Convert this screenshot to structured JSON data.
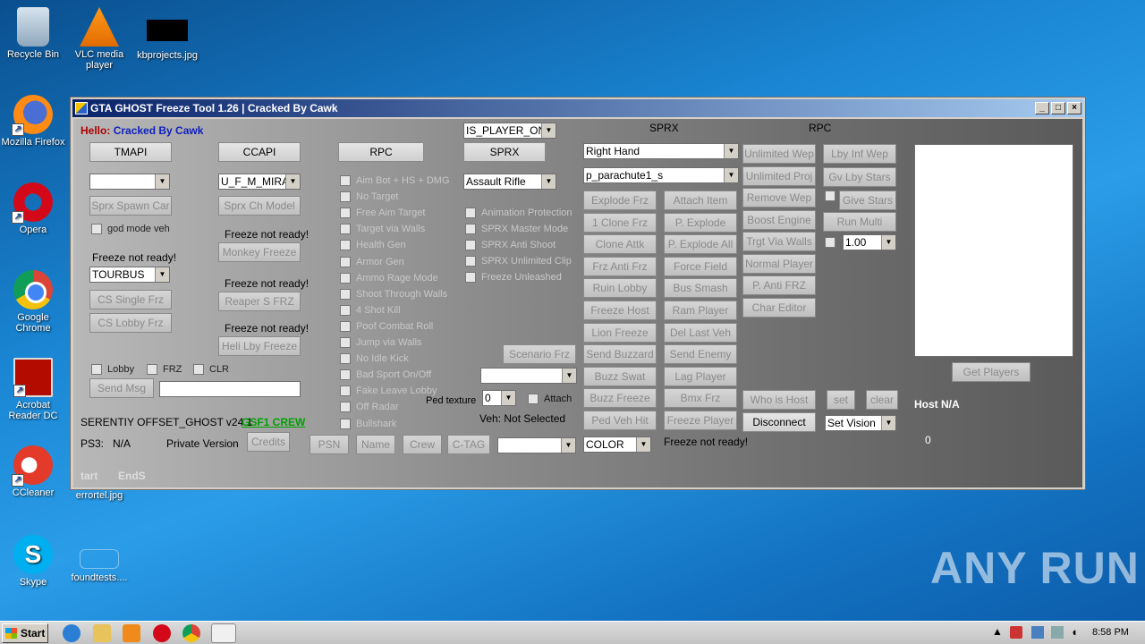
{
  "desktop": {
    "icons": [
      {
        "label": "Recycle Bin"
      },
      {
        "label": "VLC media player"
      },
      {
        "label": "kbprojects.jpg"
      },
      {
        "label": "Mozilla Firefox"
      },
      {
        "label": "Opera"
      },
      {
        "label": "Google Chrome"
      },
      {
        "label": "Acrobat Reader DC"
      },
      {
        "label": "CCleaner"
      },
      {
        "label": "errortel.jpg"
      },
      {
        "label": "Skype"
      },
      {
        "label": "foundtests...."
      }
    ],
    "watermark": "ANY RUN"
  },
  "window": {
    "title": "GTA GHOST Freeze Tool 1.26 | Cracked By Cawk",
    "hello_label": "Hello:",
    "hello_user": "Cracked By Cawk",
    "headers": {
      "sprx": "SPRX",
      "rpc": "RPC"
    },
    "col1": {
      "tmapi": "TMAPI",
      "combo_blank": "",
      "sprx_spawn_car": "Sprx Spawn Car",
      "god_mode_veh": "god mode veh",
      "freeze_not_ready": "Freeze not ready!",
      "vehicle_combo": "TOURBUS",
      "cs_single_frz": "CS Single Frz",
      "cs_lobby_frz": "CS Lobby Frz",
      "lobby": "Lobby",
      "frz": "FRZ",
      "clr": "CLR",
      "send_msg": "Send Msg"
    },
    "col2": {
      "ccapi": "CCAPI",
      "model_combo": "U_F_M_MIRAI",
      "sprx_ch_model": "Sprx Ch Model",
      "freeze_1": "Freeze not ready!",
      "monkey_freeze": "Monkey Freeze",
      "freeze_2": "Freeze not ready!",
      "reaper_frz": "Reaper S FRZ",
      "freeze_3": "Freeze not ready!",
      "heli_lby_freeze": "Heli Lby Freeze"
    },
    "col3": {
      "rpc": "RPC",
      "checks": [
        "Aim Bot + HS + DMG",
        "No Target",
        "Free Aim Target",
        "Target via Walls",
        "Health Gen",
        "Armor Gen",
        "Ammo Rage Mode",
        "Shoot Through Walls",
        "4 Shot Kill",
        "Poof Combat Roll",
        "Jump via Walls",
        "No Idle Kick",
        "Bad Sport On/Off",
        "Fake Leave Lobby",
        "Off Radar",
        "Bullshark"
      ]
    },
    "col4": {
      "player_combo": "IS_PLAYER_ONLINE",
      "sprx": "SPRX",
      "weapon_combo": "Assault Rifle",
      "checks": [
        "Animation Protection",
        "SPRX Master Mode",
        "SPRX Anti Shoot",
        "SPRX Unlimited Clip",
        "Freeze Unleashed"
      ],
      "scenario_frz": "Scenario Frz",
      "ped_texture": "Ped texture",
      "ped_texture_val": "0",
      "attach": "Attach",
      "veh_status": "Veh:  Not Selected"
    },
    "sprx_grid": {
      "hand_combo": "Right Hand",
      "obj_combo": "p_parachute1_s",
      "left": [
        "Explode Frz",
        "1 Clone Frz",
        "Clone Attk",
        "Frz Anti Frz",
        "Ruin Lobby",
        "Freeze Host",
        "Lion Freeze",
        "Send Buzzard",
        "Buzz Swat",
        "Buzz Freeze",
        "Ped Veh Hit"
      ],
      "right": [
        "Attach Item",
        "P. Explode",
        "P. Explode All",
        "Force Field",
        "Bus Smash",
        "Ram Player",
        "Del Last Veh",
        "Send Enemy",
        "Lag Player",
        "Bmx Frz",
        "Freeze Player"
      ],
      "color_combo": "COLOR",
      "freeze_status": "Freeze not ready!"
    },
    "rpc_grid": {
      "left": [
        "Unlimited Wep",
        "Unlimited Proj",
        "Remove Wep",
        "Boost Engine",
        "Trgt Via Walls",
        "Normal Player",
        "P. Anti FRZ",
        "Char Editor"
      ],
      "right": [
        "Lby Inf Wep",
        "Gv Lby Stars",
        "Give Stars",
        "Run Multi"
      ],
      "multi_val": "1.00",
      "who_is_host": "Who is Host",
      "set": "set",
      "clear": "clear",
      "disconnect": "Disconnect",
      "vision_combo": "Set Vision"
    },
    "right_panel": {
      "get_players": "Get Players",
      "host": "Host N/A",
      "count": "0"
    },
    "footer": {
      "offset_label": "SERENTIY OFFSET_GHOST  v24.1",
      "crew": "GSF1 CREW",
      "ps3_label": "PS3:",
      "ps3_val": "N/A",
      "private": "Private Version",
      "credits": "Credits",
      "psn": "PSN",
      "name": "Name",
      "crew_btn": "Crew",
      "ctag": "C-TAG",
      "start": "tart",
      "ends": "EndS"
    }
  },
  "taskbar": {
    "start": "Start",
    "time": "8:58 PM"
  }
}
